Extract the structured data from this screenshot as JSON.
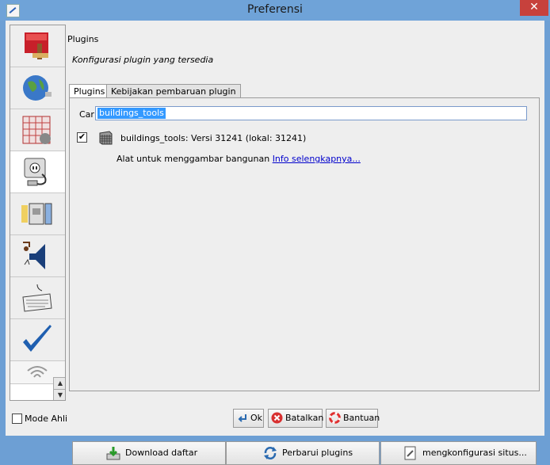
{
  "window": {
    "title": "Preferensi",
    "close": "✕"
  },
  "sidebar": {
    "items": [
      {
        "name": "display-settings-icon"
      },
      {
        "name": "connection-settings-icon"
      },
      {
        "name": "map-projection-icon"
      },
      {
        "name": "plugin-icon"
      },
      {
        "name": "files-settings-icon"
      },
      {
        "name": "audio-settings-icon"
      },
      {
        "name": "shortcuts-keyboard-icon"
      },
      {
        "name": "validator-checkmark-icon"
      },
      {
        "name": "remote-control-icon"
      }
    ],
    "scroll_up": "▲",
    "scroll_down": "▼"
  },
  "pane": {
    "header": "Plugins",
    "subtitle": "Konfigurasi plugin yang tersedia",
    "tabs": [
      {
        "label": "Plugins"
      },
      {
        "label": "Kebijakan pembaruan plugin"
      }
    ],
    "search": {
      "label": "Cari:",
      "value": "buildings_tools"
    },
    "plugin": {
      "checked": "✔",
      "title": "buildings_tools: Versi 31241 (lokal: 31241)",
      "description": "Alat untuk menggambar bangunan",
      "link": "Info selengkapnya..."
    },
    "buttons": {
      "download": "Download daftar",
      "update": "Perbarui plugins",
      "configure": "mengkonfigurasi situs..."
    }
  },
  "footer": {
    "expert_mode": "Mode Ahli",
    "ok": "Ok",
    "cancel": "Batalkan",
    "help": "Bantuan"
  },
  "colors": {
    "titlebar": "#6fa3d8",
    "close": "#c7413c",
    "link": "#0000cc",
    "selection": "#3399ff"
  }
}
